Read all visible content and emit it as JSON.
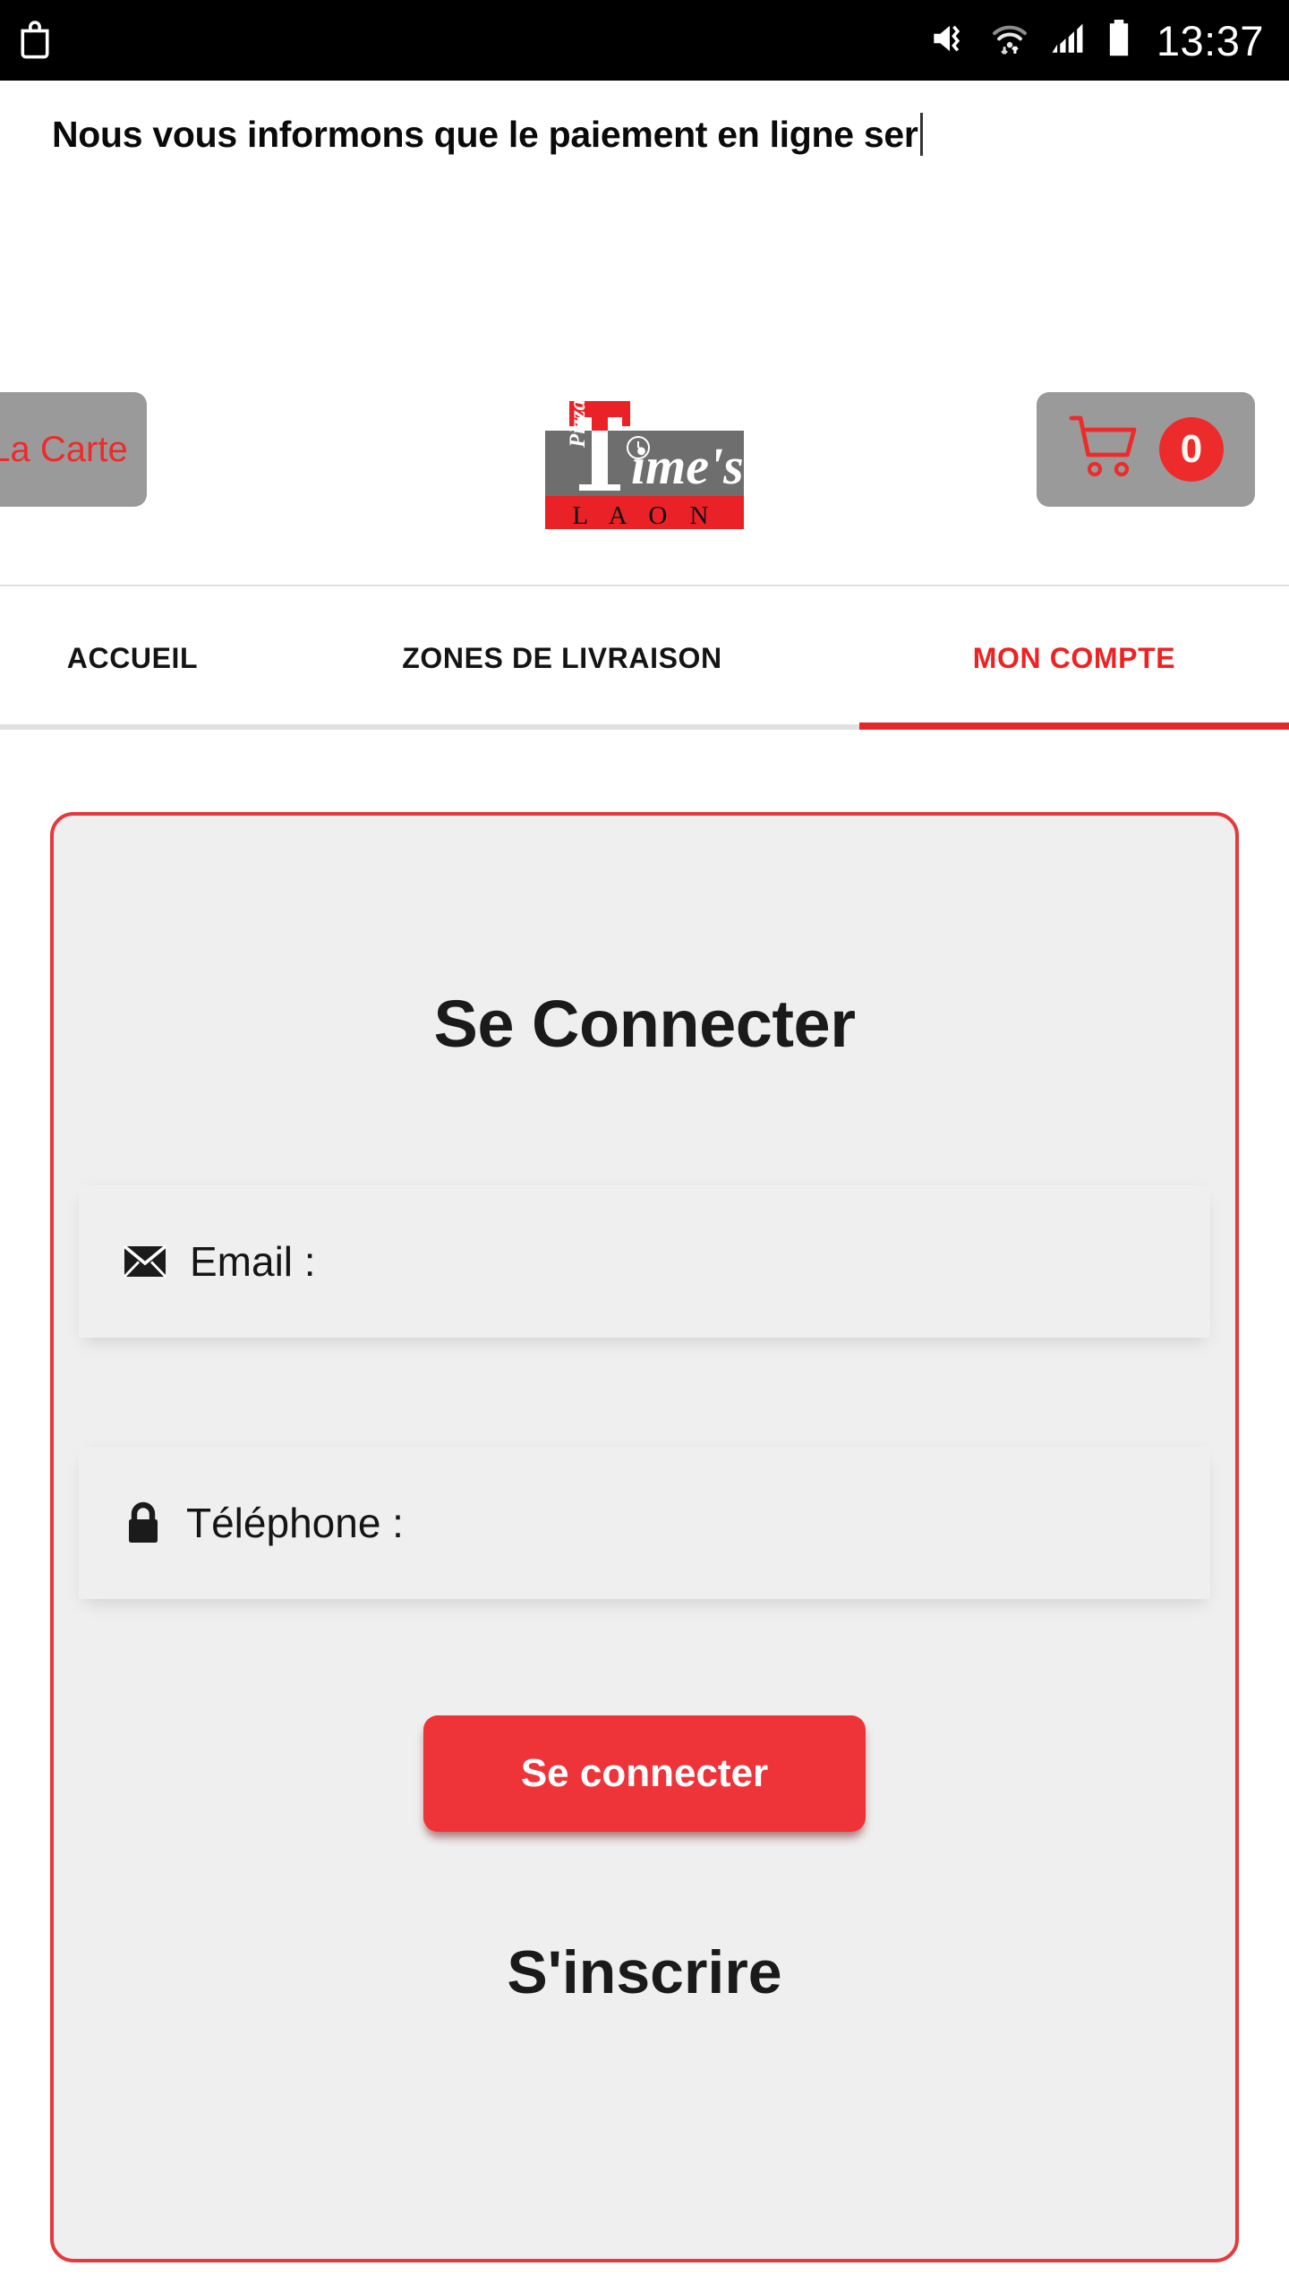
{
  "statusbar": {
    "time": "13:37",
    "icons": [
      "shopping-bag-icon",
      "mute-vibrate-icon",
      "wifi-data-icon",
      "cellular-signal-icon",
      "battery-icon"
    ]
  },
  "notice": {
    "text": "Nous vous informons que le paiement en ligne ser"
  },
  "header": {
    "menu_button_label": "La Carte",
    "logo": {
      "word_pizza": "Pizza",
      "word_times": "ime's",
      "letter_t": "T",
      "word_laon": "L A O N",
      "colors": {
        "red": "#e8252b",
        "grey": "#6e6e6e",
        "white": "#ffffff"
      }
    },
    "cart": {
      "icon": "shopping-cart-icon",
      "count": "0"
    }
  },
  "tabs": [
    {
      "label": "ACCUEIL",
      "active": false
    },
    {
      "label": "ZONES DE LIVRAISON",
      "active": false
    },
    {
      "label": "MON COMPTE",
      "active": true
    }
  ],
  "login": {
    "title": "Se Connecter",
    "email_field": {
      "icon": "envelope-icon",
      "placeholder": "Email :",
      "value": ""
    },
    "phone_field": {
      "icon": "lock-icon",
      "placeholder": "Téléphone :",
      "value": ""
    },
    "submit_label": "Se connecter",
    "signup_label": "S'inscrire"
  },
  "colors": {
    "accent_red": "#ee3339",
    "tab_active_red": "#ee2222",
    "grey_button": "#9a9a9a",
    "card_bg": "#efefef",
    "card_border": "#e53a3c"
  }
}
